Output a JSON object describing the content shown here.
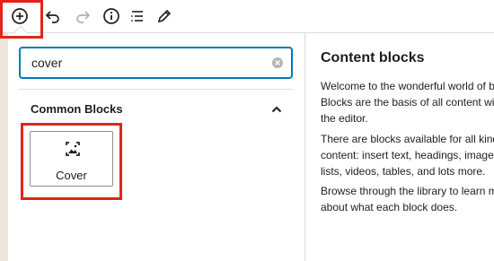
{
  "toolbar": {
    "items": [
      {
        "name": "add-block",
        "icon": "plus-circle-icon"
      },
      {
        "name": "undo",
        "icon": "undo-icon"
      },
      {
        "name": "redo",
        "icon": "redo-icon"
      },
      {
        "name": "details",
        "icon": "info-icon"
      },
      {
        "name": "outline",
        "icon": "list-view-icon"
      },
      {
        "name": "tools",
        "icon": "pencil-icon"
      }
    ]
  },
  "search": {
    "value": "cover",
    "clear_icon": "clear-circle-icon"
  },
  "block_group": {
    "title": "Common Blocks",
    "toggle_icon": "chevron-up-icon",
    "blocks": [
      {
        "label": "Cover",
        "icon": "cover-image-icon"
      }
    ]
  },
  "info_panel": {
    "title": "Content blocks",
    "paragraph_1": [
      "Welcome to the wonderful world of blo",
      "Blocks are the basis of all content with",
      "the editor."
    ],
    "paragraph_2": [
      "There are blocks available for all kinds",
      "content: insert text, headings, images,",
      "lists, videos, tables, and lots more."
    ],
    "paragraph_3": [
      "Browse through the library to learn mo",
      "about what each block does."
    ]
  },
  "colors": {
    "accent": "#007cba",
    "highlight": "#e1251b",
    "text": "#1e1e1e",
    "border": "#dcdcde"
  }
}
